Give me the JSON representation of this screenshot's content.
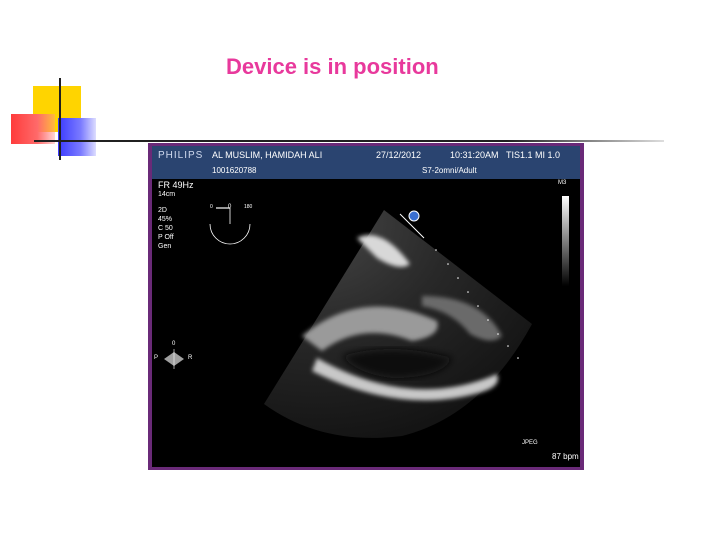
{
  "slide": {
    "title": "Device is in position"
  },
  "ultrasound": {
    "brand": "PHILIPS",
    "patient_name": "AL MUSLIM, HAMIDAH ALI",
    "date": "27/12/2012",
    "time": "10:31:20AM",
    "indices": "TIS1.1   MI 1.0",
    "patient_id": "1001620788",
    "probe_preset": "S7-2omni/Adult",
    "frame_rate": "FR 49Hz",
    "depth": "14cm",
    "settings": [
      "2D",
      "45%",
      "C 50",
      "P Off",
      "Gen"
    ],
    "scale_label": "M3",
    "angle_min": "0",
    "angle_value": "0",
    "angle_max": "180",
    "orientation_top": "0",
    "orientation_left": "P",
    "orientation_right": "R",
    "format": "JPEG",
    "heart_rate": "87 bpm"
  },
  "colors": {
    "title": "#e8399c",
    "frame_border": "#6a2a78",
    "header_bar": "#2a4470"
  }
}
